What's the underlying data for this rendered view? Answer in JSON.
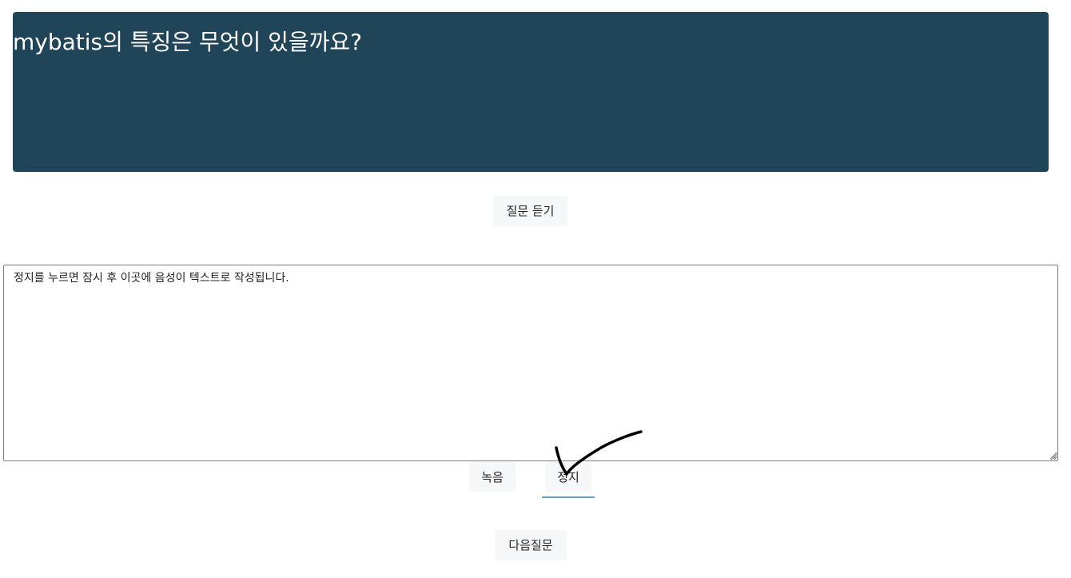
{
  "question": {
    "text": "mybatis의 특징은 무엇이 있을까요?",
    "banner_color": "#204558"
  },
  "buttons": {
    "listen_label": "질문 듣기",
    "record_label": "녹음",
    "stop_label": "정지",
    "next_label": "다음질문"
  },
  "answer": {
    "value": "정지를 누르면 잠시 후 이곳에 음성이 텍스트로 작성됩니다."
  },
  "colors": {
    "button_bg": "#f6f7f8",
    "active_underline": "#6e9fb8"
  },
  "icons": {
    "annotation": "checkmark-icon",
    "textarea_grip": "resize-grip-icon"
  }
}
